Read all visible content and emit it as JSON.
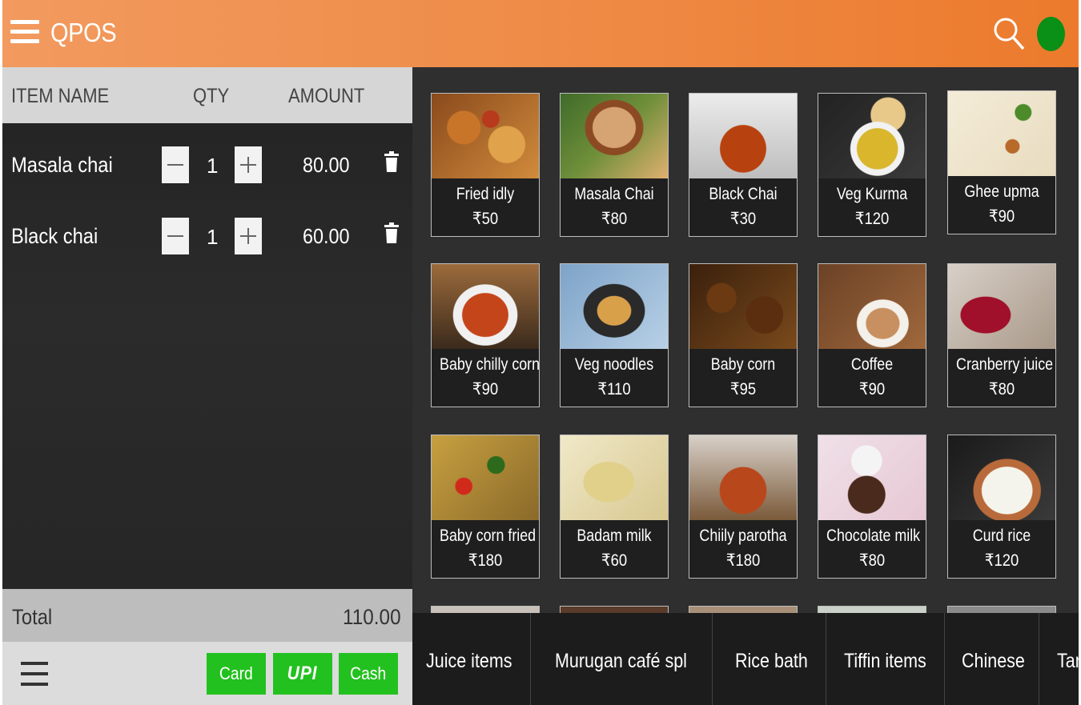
{
  "header": {
    "title": "QPOS"
  },
  "order": {
    "columns": {
      "item": "ITEM NAME",
      "qty": "QTY",
      "amount": "AMOUNT"
    },
    "items": [
      {
        "name": "Masala chai",
        "qty": "1",
        "amount": "80.00"
      },
      {
        "name": "Black chai",
        "qty": "1",
        "amount": "60.00"
      }
    ],
    "total_label": "Total",
    "total_value": "110.00"
  },
  "payment": {
    "card": "Card",
    "upi": "UPI",
    "cash": "Cash"
  },
  "menu": [
    {
      "name": "Fried idly",
      "price": "₹50"
    },
    {
      "name": "Masala Chai",
      "price": "₹80"
    },
    {
      "name": "Black Chai",
      "price": "₹30"
    },
    {
      "name": "Veg Kurma",
      "price": "₹120"
    },
    {
      "name": "Ghee upma",
      "price": "₹90"
    },
    {
      "name": "Baby chilly corn",
      "price": "₹90"
    },
    {
      "name": "Veg noodles",
      "price": "₹110"
    },
    {
      "name": "Baby corn",
      "price": "₹95"
    },
    {
      "name": "Coffee",
      "price": "₹90"
    },
    {
      "name": "Cranberry juice",
      "price": "₹80"
    },
    {
      "name": "Baby corn fried",
      "price": "₹180"
    },
    {
      "name": "Badam milk",
      "price": "₹60"
    },
    {
      "name": "Chiily parotha",
      "price": "₹180"
    },
    {
      "name": "Chocolate milk",
      "price": "₹80"
    },
    {
      "name": "Curd rice",
      "price": "₹120"
    }
  ],
  "categories": [
    "Juice items",
    "Murugan café spl",
    "Rice bath",
    "Tiffin items",
    "Chinese",
    "Tandoori"
  ],
  "colors": {
    "header": "#ee8a45",
    "pay_button": "#23c11f",
    "status": "#0a8f17"
  }
}
